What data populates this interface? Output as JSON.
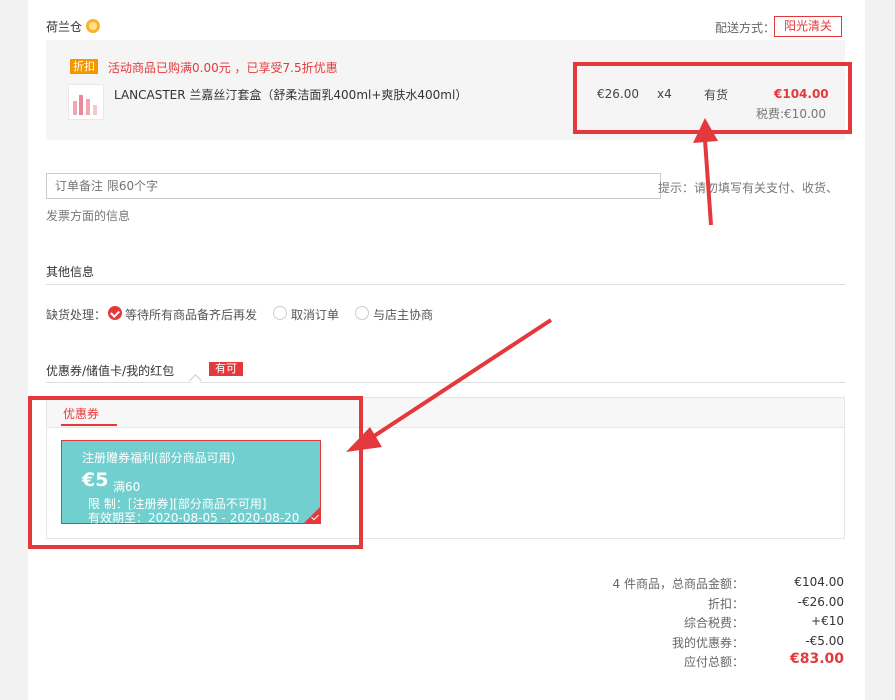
{
  "store": {
    "warehouse": "荷兰仓",
    "shipping_label": "配送方式：",
    "shipping_method": "阳光清关"
  },
  "promo": {
    "tag": "折扣",
    "text": "活动商品已购满0.00元 ，已享受7.5折优惠"
  },
  "product": {
    "name": "LANCASTER 兰嘉丝汀套盒（舒柔洁面乳400ml+爽肤水400ml）",
    "price": "€26.00",
    "qty": "x4",
    "stock": "有货",
    "subtotal": "€104.00",
    "tax": "税费:€10.00"
  },
  "remark": {
    "placeholder": "订单备注 限60个字",
    "tip_line1": "提示：请勿填写有关支付、收货、",
    "tip_line2": "发票方面的信息"
  },
  "other_info": {
    "title": "其他信息",
    "oos_label": "缺货处理：",
    "options": [
      {
        "label": "等待所有商品备齐后再发",
        "selected": true
      },
      {
        "label": "取消订单",
        "selected": false
      },
      {
        "label": "与店主协商",
        "selected": false
      }
    ]
  },
  "coupons": {
    "title": "优惠券/储值卡/我的红包",
    "badge": "有可",
    "tab": "优惠券",
    "card": {
      "title": "注册赠券福利(部分商品可用)",
      "amount": "€5",
      "min": "满60",
      "limit": "限 制：[注册券][部分商品不可用]",
      "valid": "有效期至：2020-08-05 - 2020-08-20",
      "color": "#72cfcf"
    }
  },
  "summary": [
    {
      "label": "4 件商品，总商品金额：",
      "value": "€104.00"
    },
    {
      "label": "折扣：",
      "value": "-€26.00"
    },
    {
      "label": "综合税费：",
      "value": "+€10"
    },
    {
      "label": "我的优惠券：",
      "value": "-€5.00"
    },
    {
      "label": "应付总额：",
      "value": "€83.00",
      "total": true
    }
  ],
  "colors": {
    "accent": "#e4393c",
    "promo_tag": "#f39800",
    "coupon_card": "#72cfcf"
  }
}
